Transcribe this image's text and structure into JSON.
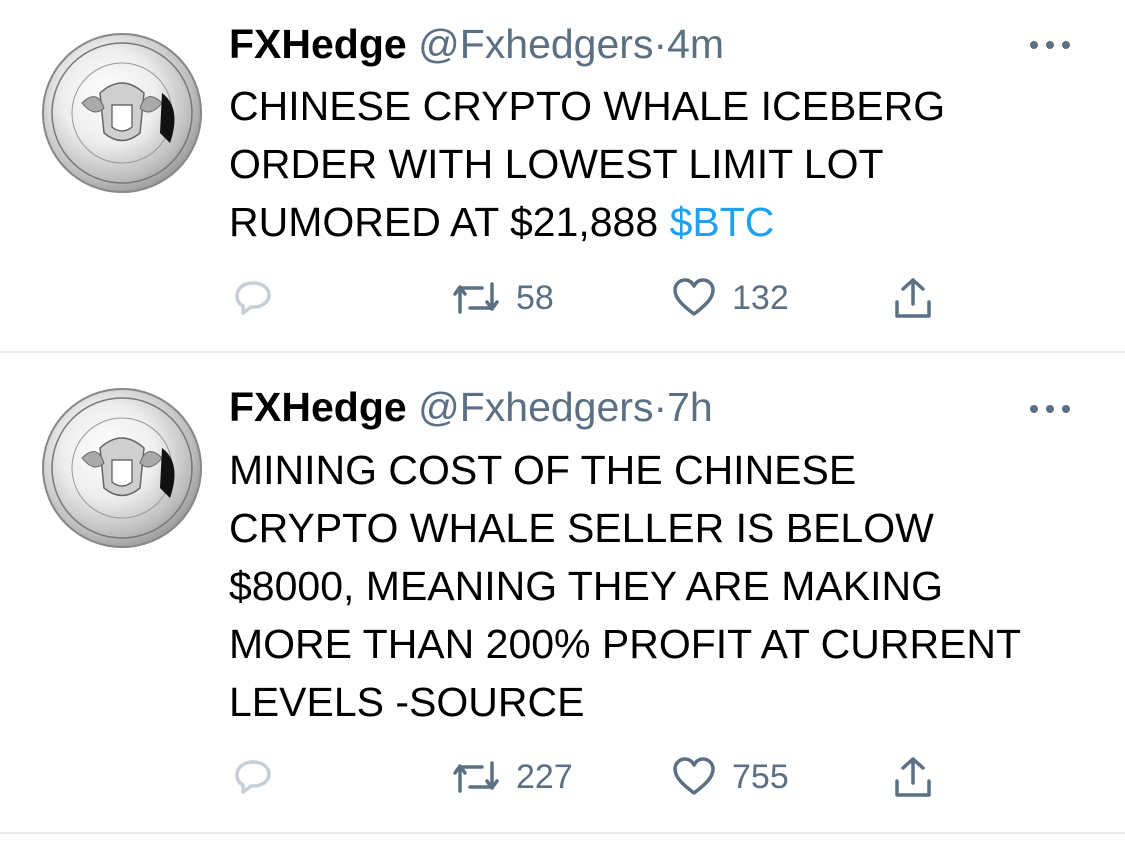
{
  "tweets": [
    {
      "name": "FXHedge",
      "handle": "@Fxhedgers",
      "separator": "·",
      "time": "4m",
      "text": "CHINESE CRYPTO WHALE ICEBERG\nORDER WITH LOWEST LIMIT LOT\nRUMORED AT $21,888 ",
      "cashtag": "$BTC",
      "retweets": "58",
      "likes": "132",
      "icons": [
        "reply-icon",
        "retweet-icon",
        "like-icon",
        "share-icon",
        "more-icon"
      ]
    },
    {
      "name": "FXHedge",
      "handle": "@Fxhedgers",
      "separator": "·",
      "time": "7h",
      "text": "MINING COST OF THE CHINESE\nCRYPTO WHALE SELLER IS BELOW\n$8000, MEANING THEY ARE MAKING\nMORE THAN 200% PROFIT AT CURRENT\nLEVELS -SOURCE",
      "cashtag": "",
      "retweets": "227",
      "likes": "755",
      "icons": [
        "reply-icon",
        "retweet-icon",
        "like-icon",
        "share-icon",
        "more-icon"
      ]
    }
  ],
  "colors": {
    "secondary": "#5b7083",
    "link": "#1da1f2",
    "divider": "#e6ecf0"
  }
}
